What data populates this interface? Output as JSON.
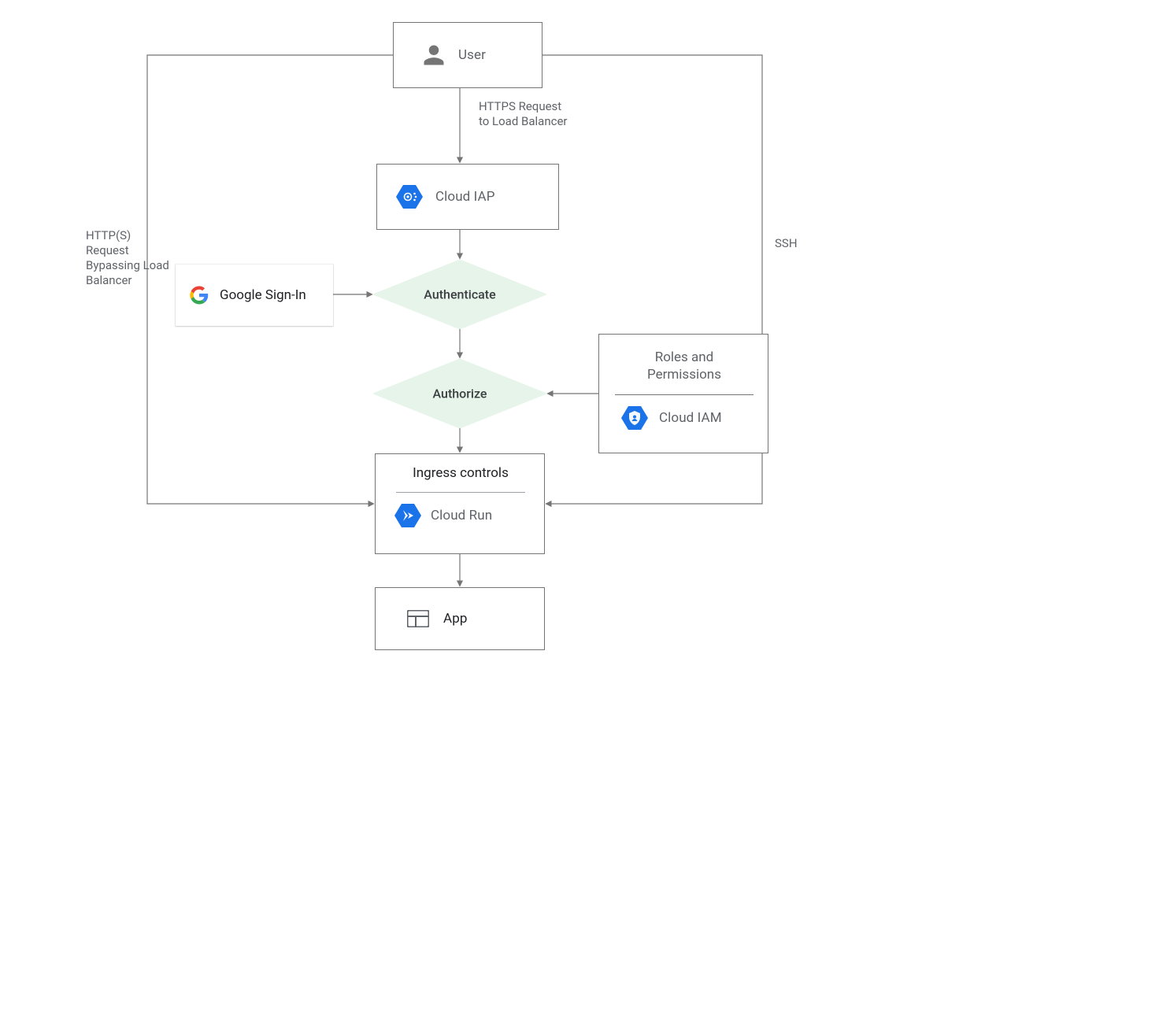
{
  "nodes": {
    "user": {
      "label": "User"
    },
    "cloud_iap": {
      "label": "Cloud IAP"
    },
    "authenticate": {
      "label": "Authenticate"
    },
    "google_signin": {
      "label": "Google Sign-In"
    },
    "authorize": {
      "label": "Authorize"
    },
    "roles_perms": {
      "title_line1": "Roles and",
      "title_line2": "Permissions",
      "cloud_iam": "Cloud IAM"
    },
    "ingress": {
      "title": "Ingress controls",
      "cloud_run": "Cloud Run"
    },
    "app": {
      "label": "App"
    }
  },
  "edge_labels": {
    "https_request": {
      "line1": "HTTPS Request",
      "line2": "to Load Balancer"
    },
    "bypass": {
      "line1": "HTTP(S)",
      "line2": "Request",
      "line3": "Bypassing Load",
      "line4": "Balancer"
    },
    "ssh": {
      "text": "SSH"
    }
  },
  "icons": {
    "user": "user-icon",
    "google_logo": "google-logo-icon",
    "cloud_iap": "cloud-iap-icon",
    "cloud_iam": "cloud-iam-icon",
    "cloud_run": "cloud-run-icon",
    "app": "window-icon"
  }
}
